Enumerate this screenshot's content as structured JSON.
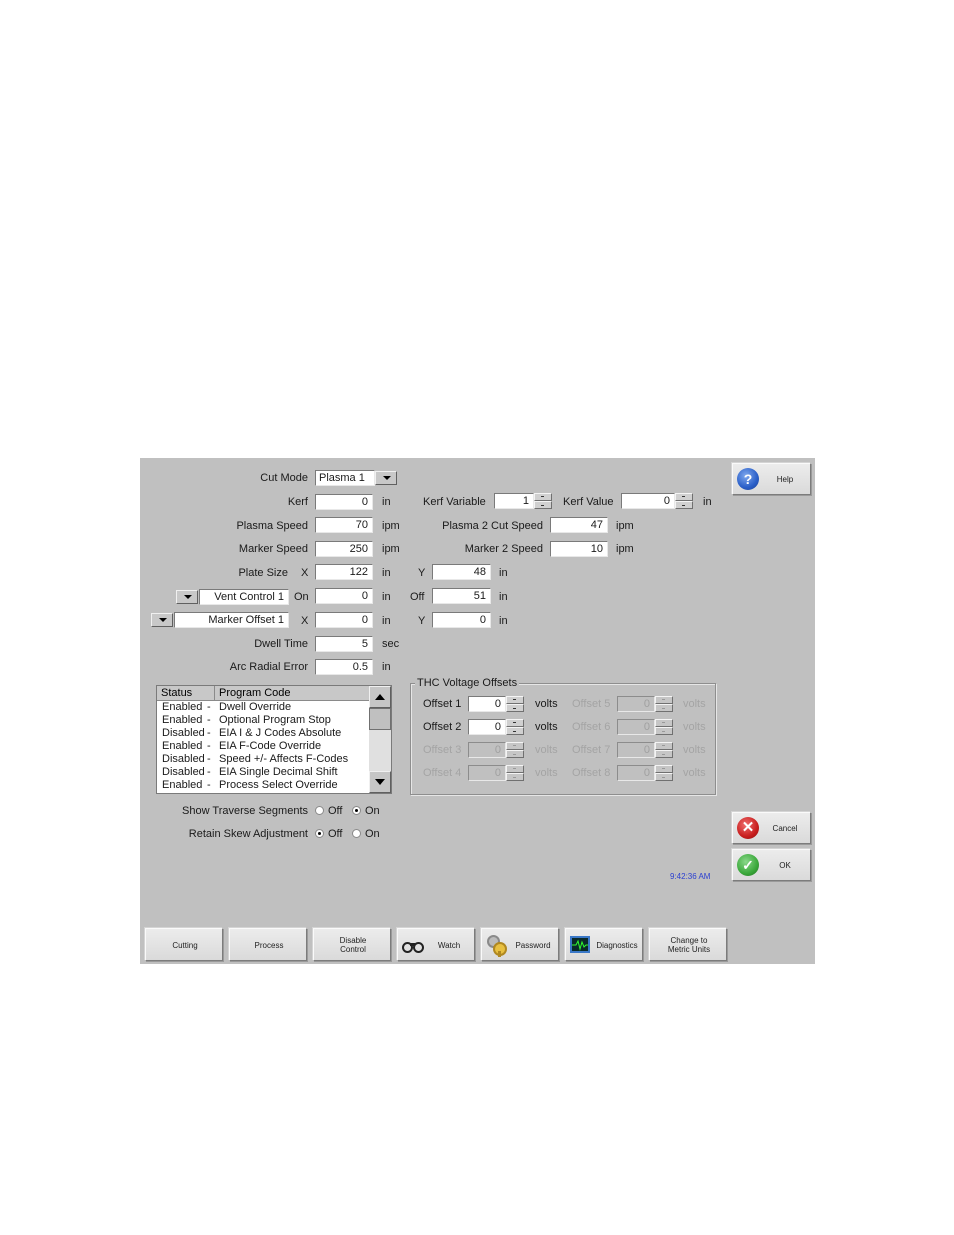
{
  "form": {
    "cut_mode": {
      "label": "Cut Mode",
      "value": "Plasma 1"
    },
    "kerf": {
      "label": "Kerf",
      "value": "0",
      "unit": "in"
    },
    "plasma_speed": {
      "label": "Plasma Speed",
      "value": "70",
      "unit": "ipm"
    },
    "marker_speed": {
      "label": "Marker Speed",
      "value": "250",
      "unit": "ipm"
    },
    "plate_size": {
      "label": "Plate Size",
      "x_label": "X",
      "x_value": "122",
      "x_unit": "in",
      "y_label": "Y",
      "y_value": "48",
      "y_unit": "in"
    },
    "vent_control": {
      "select_value": "Vent Control 1",
      "on_label": "On",
      "on_value": "0",
      "on_unit": "in",
      "off_label": "Off",
      "off_value": "51",
      "off_unit": "in"
    },
    "marker_offset": {
      "select_value": "Marker Offset 1",
      "x_label": "X",
      "x_value": "0",
      "x_unit": "in",
      "y_label": "Y",
      "y_value": "0",
      "y_unit": "in"
    },
    "dwell_time": {
      "label": "Dwell Time",
      "value": "5",
      "unit": "sec"
    },
    "arc_radial_error": {
      "label": "Arc Radial Error",
      "value": "0.5",
      "unit": "in"
    },
    "kerf_variable": {
      "label": "Kerf Variable",
      "value": "1"
    },
    "kerf_value": {
      "label": "Kerf Value",
      "value": "0",
      "unit": "in"
    },
    "plasma2_cut_speed": {
      "label": "Plasma 2 Cut Speed",
      "value": "47",
      "unit": "ipm"
    },
    "marker2_speed": {
      "label": "Marker 2 Speed",
      "value": "10",
      "unit": "ipm"
    }
  },
  "program_codes": {
    "headers": [
      "Status",
      "Program Code"
    ],
    "rows": [
      {
        "status": "Enabled",
        "sep": "-",
        "code": "Dwell Override"
      },
      {
        "status": "Enabled",
        "sep": "-",
        "code": "Optional Program Stop"
      },
      {
        "status": "Disabled",
        "sep": "-",
        "code": "EIA I & J Codes Absolute"
      },
      {
        "status": "Enabled",
        "sep": "-",
        "code": "EIA F-Code Override"
      },
      {
        "status": "Disabled",
        "sep": "-",
        "code": "Speed +/- Affects F-Codes"
      },
      {
        "status": "Disabled",
        "sep": "-",
        "code": "EIA Single Decimal Shift"
      },
      {
        "status": "Enabled",
        "sep": "-",
        "code": "Process Select Override"
      }
    ]
  },
  "thc": {
    "title": "THC Voltage Offsets",
    "unit": "volts",
    "offsets": [
      {
        "label": "Offset 1",
        "value": "0",
        "enabled": true
      },
      {
        "label": "Offset 2",
        "value": "0",
        "enabled": true
      },
      {
        "label": "Offset 3",
        "value": "0",
        "enabled": false
      },
      {
        "label": "Offset 4",
        "value": "0",
        "enabled": false
      },
      {
        "label": "Offset 5",
        "value": "0",
        "enabled": false
      },
      {
        "label": "Offset 6",
        "value": "0",
        "enabled": false
      },
      {
        "label": "Offset 7",
        "value": "0",
        "enabled": false
      },
      {
        "label": "Offset 8",
        "value": "0",
        "enabled": false
      }
    ]
  },
  "options": {
    "show_traverse": {
      "label": "Show Traverse Segments",
      "off_label": "Off",
      "on_label": "On",
      "selected": "On"
    },
    "retain_skew": {
      "label": "Retain Skew Adjustment",
      "off_label": "Off",
      "on_label": "On",
      "selected": "Off"
    }
  },
  "side_buttons": {
    "help": "Help",
    "cancel": "Cancel",
    "ok": "OK"
  },
  "clock": "9:42:36 AM",
  "softkeys": [
    {
      "label": "Cutting",
      "line2": ""
    },
    {
      "label": "Process",
      "line2": ""
    },
    {
      "label": "Disable",
      "line2": "Control"
    },
    {
      "label": "Watch",
      "line2": ""
    },
    {
      "label": "Password",
      "line2": ""
    },
    {
      "label": "Diagnostics",
      "line2": ""
    },
    {
      "label": "Change to",
      "line2": "Metric Units"
    }
  ],
  "colors": {
    "panel_bg": "#c0c0c0",
    "clock_text": "#2a3fd0",
    "help_blue": "#2a5fc8",
    "cancel_red": "#c81e1e",
    "ok_green": "#3aa83a"
  }
}
